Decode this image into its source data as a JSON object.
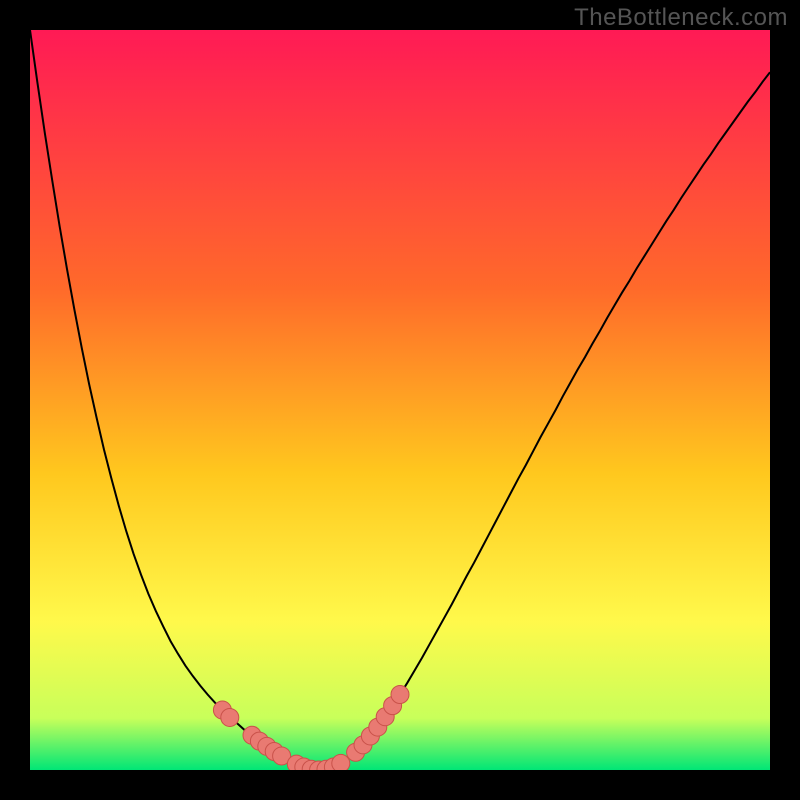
{
  "watermark": "TheBottleneck.com",
  "colors": {
    "gradient_top": "#ff1a55",
    "gradient_mid1": "#ff6a2a",
    "gradient_mid2": "#ffc81e",
    "gradient_mid3": "#fff94b",
    "gradient_bot1": "#c8ff5a",
    "gradient_bot2": "#00e676",
    "curve": "#000000",
    "marker_fill": "#e97a72",
    "marker_stroke": "#c9524a",
    "frame": "#000000"
  },
  "chart_data": {
    "type": "line",
    "title": "",
    "xlabel": "",
    "ylabel": "",
    "xlim": [
      0,
      100
    ],
    "ylim": [
      0,
      100
    ],
    "grid": false,
    "x": [
      0,
      1,
      2,
      3,
      4,
      5,
      6,
      7,
      8,
      9,
      10,
      11,
      12,
      13,
      14,
      15,
      16,
      17,
      18,
      19,
      20,
      21,
      22,
      23,
      24,
      25,
      26,
      27,
      28,
      29,
      30,
      31,
      32,
      33,
      34,
      35,
      36,
      37,
      38,
      39,
      40,
      41,
      42,
      43,
      44,
      45,
      46,
      47,
      48,
      49,
      50,
      51,
      52,
      53,
      54,
      55,
      56,
      57,
      58,
      59,
      60,
      61,
      62,
      63,
      64,
      65,
      66,
      67,
      68,
      69,
      70,
      71,
      72,
      73,
      74,
      75,
      76,
      77,
      78,
      79,
      80,
      81,
      82,
      83,
      84,
      85,
      86,
      87,
      88,
      89,
      90,
      91,
      92,
      93,
      94,
      95,
      96,
      97,
      98,
      99,
      100
    ],
    "series": [
      {
        "name": "bottleneck-curve",
        "values": [
          100,
          92.9,
          86.1,
          79.7,
          73.5,
          67.7,
          62.2,
          57.0,
          52.1,
          47.6,
          43.3,
          39.4,
          35.7,
          32.3,
          29.2,
          26.4,
          23.8,
          21.5,
          19.4,
          17.4,
          15.7,
          14.1,
          12.7,
          11.4,
          10.2,
          9.1,
          8.1,
          7.1,
          6.3,
          5.4,
          4.7,
          3.9,
          3.2,
          2.5,
          1.9,
          1.3,
          0.8,
          0.4,
          0.1,
          0.0,
          0.1,
          0.4,
          0.9,
          1.6,
          2.4,
          3.4,
          4.6,
          5.8,
          7.2,
          8.7,
          10.2,
          11.8,
          13.5,
          15.2,
          17.0,
          18.8,
          20.6,
          22.4,
          24.3,
          26.2,
          28.0,
          29.9,
          31.8,
          33.7,
          35.6,
          37.5,
          39.4,
          41.2,
          43.1,
          45.0,
          46.8,
          48.6,
          50.5,
          52.3,
          54.1,
          55.8,
          57.6,
          59.3,
          61.1,
          62.8,
          64.5,
          66.1,
          67.8,
          69.4,
          71.0,
          72.6,
          74.2,
          75.7,
          77.3,
          78.8,
          80.3,
          81.8,
          83.2,
          84.7,
          86.1,
          87.5,
          88.9,
          90.3,
          91.6,
          93.0,
          94.3
        ]
      }
    ],
    "markers": {
      "name": "highlighted-points",
      "points": [
        {
          "x": 26,
          "y": 8.1
        },
        {
          "x": 27,
          "y": 7.1
        },
        {
          "x": 30,
          "y": 4.7
        },
        {
          "x": 31,
          "y": 3.9
        },
        {
          "x": 32,
          "y": 3.2
        },
        {
          "x": 33,
          "y": 2.5
        },
        {
          "x": 34,
          "y": 1.9
        },
        {
          "x": 36,
          "y": 0.8
        },
        {
          "x": 37,
          "y": 0.4
        },
        {
          "x": 38,
          "y": 0.1
        },
        {
          "x": 39,
          "y": 0.0
        },
        {
          "x": 40,
          "y": 0.1
        },
        {
          "x": 41,
          "y": 0.4
        },
        {
          "x": 42,
          "y": 0.9
        },
        {
          "x": 44,
          "y": 2.4
        },
        {
          "x": 45,
          "y": 3.4
        },
        {
          "x": 46,
          "y": 4.6
        },
        {
          "x": 47,
          "y": 5.8
        },
        {
          "x": 48,
          "y": 7.2
        },
        {
          "x": 49,
          "y": 8.7
        },
        {
          "x": 50,
          "y": 10.2
        }
      ]
    }
  }
}
